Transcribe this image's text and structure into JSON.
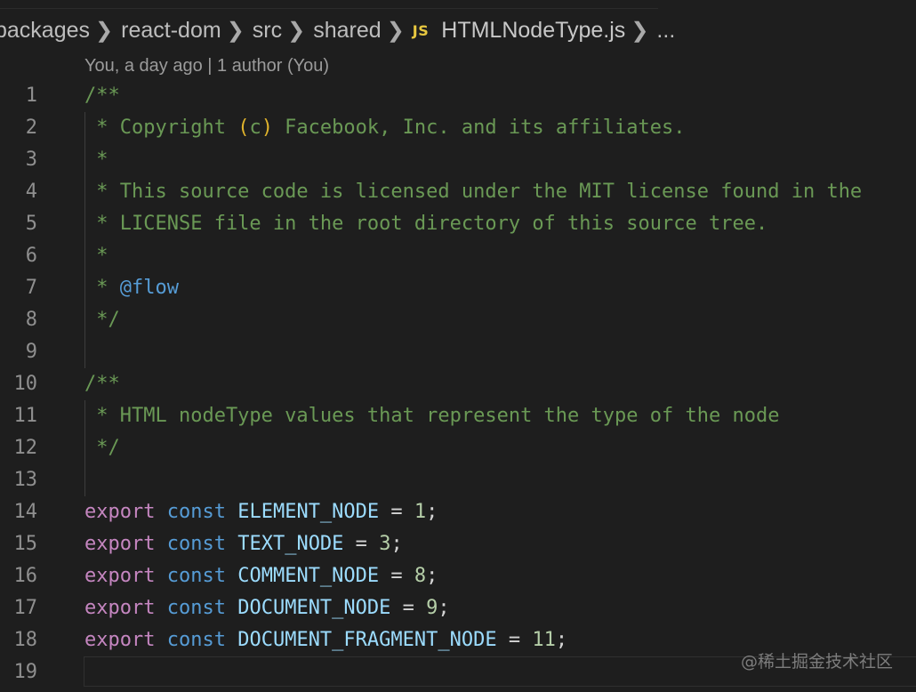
{
  "breadcrumb": {
    "items": [
      "packages",
      "react-dom",
      "src",
      "shared"
    ],
    "file_icon": "JS",
    "file_name": "HTMLNodeType.js",
    "ellipsis": "..."
  },
  "codelens": {
    "text": "You, a day ago | 1 author (You)"
  },
  "editor": {
    "language": "javascript",
    "line_numbers": [
      "1",
      "2",
      "3",
      "4",
      "5",
      "6",
      "7",
      "8",
      "9",
      "10",
      "11",
      "12",
      "13",
      "14",
      "15",
      "16",
      "17",
      "18",
      "19"
    ],
    "lines": [
      {
        "tokens": [
          {
            "t": "comment",
            "v": "/**"
          }
        ]
      },
      {
        "tokens": [
          {
            "t": "comment",
            "v": " * Copyright "
          },
          {
            "t": "paren",
            "v": "("
          },
          {
            "t": "comment",
            "v": "c"
          },
          {
            "t": "paren",
            "v": ")"
          },
          {
            "t": "comment",
            "v": " Facebook, Inc. and its affiliates."
          }
        ]
      },
      {
        "tokens": [
          {
            "t": "comment",
            "v": " *"
          }
        ]
      },
      {
        "tokens": [
          {
            "t": "comment",
            "v": " * This source code is licensed under the MIT license found in the"
          }
        ]
      },
      {
        "tokens": [
          {
            "t": "comment",
            "v": " * LICENSE file in the root directory of this source tree."
          }
        ]
      },
      {
        "tokens": [
          {
            "t": "comment",
            "v": " *"
          }
        ]
      },
      {
        "tokens": [
          {
            "t": "comment",
            "v": " * "
          },
          {
            "t": "tag",
            "v": "@flow"
          }
        ]
      },
      {
        "tokens": [
          {
            "t": "comment",
            "v": " */"
          }
        ]
      },
      {
        "tokens": []
      },
      {
        "tokens": [
          {
            "t": "comment",
            "v": "/**"
          }
        ]
      },
      {
        "tokens": [
          {
            "t": "comment",
            "v": " * HTML nodeType values that represent the type of the node"
          }
        ]
      },
      {
        "tokens": [
          {
            "t": "comment",
            "v": " */"
          }
        ]
      },
      {
        "tokens": []
      },
      {
        "tokens": [
          {
            "t": "kw",
            "v": "export"
          },
          {
            "t": "op",
            "v": " "
          },
          {
            "t": "storage",
            "v": "const"
          },
          {
            "t": "op",
            "v": " "
          },
          {
            "t": "const",
            "v": "ELEMENT_NODE"
          },
          {
            "t": "op",
            "v": " = "
          },
          {
            "t": "num",
            "v": "1"
          },
          {
            "t": "punct",
            "v": ";"
          }
        ]
      },
      {
        "tokens": [
          {
            "t": "kw",
            "v": "export"
          },
          {
            "t": "op",
            "v": " "
          },
          {
            "t": "storage",
            "v": "const"
          },
          {
            "t": "op",
            "v": " "
          },
          {
            "t": "const",
            "v": "TEXT_NODE"
          },
          {
            "t": "op",
            "v": " = "
          },
          {
            "t": "num",
            "v": "3"
          },
          {
            "t": "punct",
            "v": ";"
          }
        ]
      },
      {
        "tokens": [
          {
            "t": "kw",
            "v": "export"
          },
          {
            "t": "op",
            "v": " "
          },
          {
            "t": "storage",
            "v": "const"
          },
          {
            "t": "op",
            "v": " "
          },
          {
            "t": "const",
            "v": "COMMENT_NODE"
          },
          {
            "t": "op",
            "v": " = "
          },
          {
            "t": "num",
            "v": "8"
          },
          {
            "t": "punct",
            "v": ";"
          }
        ]
      },
      {
        "tokens": [
          {
            "t": "kw",
            "v": "export"
          },
          {
            "t": "op",
            "v": " "
          },
          {
            "t": "storage",
            "v": "const"
          },
          {
            "t": "op",
            "v": " "
          },
          {
            "t": "const",
            "v": "DOCUMENT_NODE"
          },
          {
            "t": "op",
            "v": " = "
          },
          {
            "t": "num",
            "v": "9"
          },
          {
            "t": "punct",
            "v": ";"
          }
        ]
      },
      {
        "tokens": [
          {
            "t": "kw",
            "v": "export"
          },
          {
            "t": "op",
            "v": " "
          },
          {
            "t": "storage",
            "v": "const"
          },
          {
            "t": "op",
            "v": " "
          },
          {
            "t": "const",
            "v": "DOCUMENT_FRAGMENT_NODE"
          },
          {
            "t": "op",
            "v": " = "
          },
          {
            "t": "num",
            "v": "11"
          },
          {
            "t": "punct",
            "v": ";"
          }
        ]
      },
      {
        "tokens": []
      }
    ],
    "current_line": 19
  },
  "colors": {
    "background": "#1e1e1e",
    "comment": "#6a9955",
    "keyword_export": "#c586c0",
    "storage_const": "#569cd6",
    "constant_name": "#9cdcfe",
    "number": "#b5cea8",
    "js_icon": "#e8c840"
  },
  "watermark": {
    "text": "@稀土掘金技术社区"
  }
}
